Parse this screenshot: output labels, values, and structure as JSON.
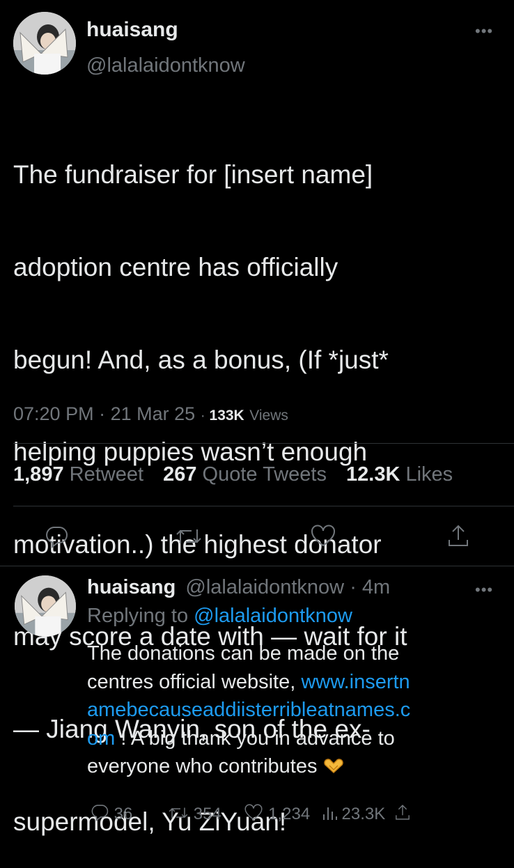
{
  "main_tweet": {
    "display_name": "huaisang",
    "handle": "@lalalaidontknow",
    "more_icon": "more-horizontal-icon",
    "text_lines": [
      "The fundraiser for [insert name]",
      "adoption centre has officially",
      "begun! And, as a bonus, (If *just*",
      "helping puppies wasn’t enough",
      "motivation..) the highest donator",
      "may score a date with — wait for it",
      "— Jiang Wanyin, son of the ex-",
      "supermodel, Yu ZiYuan!"
    ],
    "time": "07:20 PM",
    "date": "21 Mar 25",
    "views_count": "133K",
    "views_label": "Views",
    "stats": {
      "retweets_count": "1,897",
      "retweets_label": "Retweet",
      "quotes_count": "267",
      "quotes_label": "Quote Tweets",
      "likes_count": "12.3K",
      "likes_label": "Likes"
    },
    "actions": [
      "reply-icon",
      "retweet-icon",
      "like-icon",
      "share-icon"
    ]
  },
  "reply": {
    "display_name": "huaisang",
    "handle": "@lalalaidontknow",
    "time_ago": "4m",
    "replying_prefix": "Replying to",
    "replying_handle": "@lalalaidontknow",
    "text": {
      "line1": "The donations can be made on the",
      "line2_prefix": "centres official website, ",
      "link_part1": "www.insertn",
      "link_part2": "amebecauseaddiisterribleatnames.c",
      "link_part3": "om",
      "line4_suffix": " ! A big thank you in advance to",
      "line5": "everyone who contributes",
      "emoji": "🫶"
    },
    "counts": {
      "replies": "36",
      "retweets": "354",
      "likes": "1,234",
      "views": "23.3K"
    }
  },
  "colors": {
    "background": "#000000",
    "text": "#e7e9ea",
    "secondary": "#71767b",
    "link": "#1d9bf0",
    "divider": "#2f3336"
  }
}
